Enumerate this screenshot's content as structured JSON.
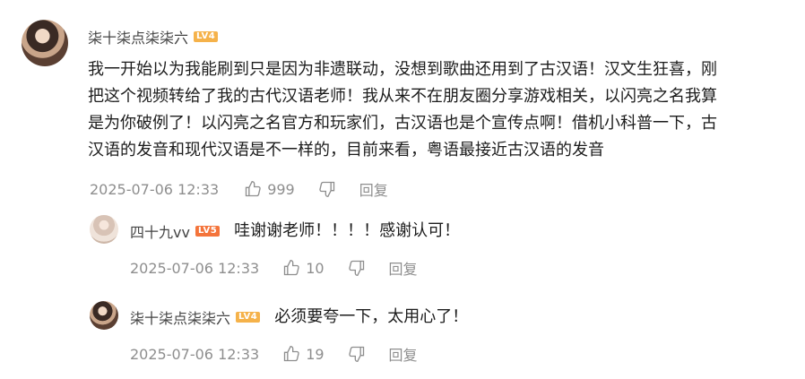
{
  "comment": {
    "username": "柒十柒点柒柒六",
    "level": "LV4",
    "text_lines": [
      "我一开始以为我能刷到只是因为非遗联动，没想到歌曲还用到了古汉语！汉文生狂喜，刚",
      "把这个视频转给了我的古代汉语老师！我从来不在朋友圈分享游戏相关，以闪亮之名我算",
      "是为你破例了！以闪亮之名官方和玩家们，古汉语也是个宣传点啊！借机小科普一下，古",
      "汉语的发音和现代汉语是不一样的，目前来看，粤语最接近古汉语的发音"
    ],
    "time": "2025-07-06 12:33",
    "likes": "999",
    "reply_label": "回复"
  },
  "replies": [
    {
      "username": "四十九vv",
      "level": "LV5",
      "text": "哇谢谢老师！！！！感谢认可！",
      "time": "2025-07-06 12:33",
      "likes": "10",
      "reply_label": "回复"
    },
    {
      "username": "柒十柒点柒柒六",
      "level": "LV4",
      "text": "必须要夸一下，太用心了！",
      "time": "2025-07-06 12:33",
      "likes": "19",
      "reply_label": "回复"
    }
  ]
}
